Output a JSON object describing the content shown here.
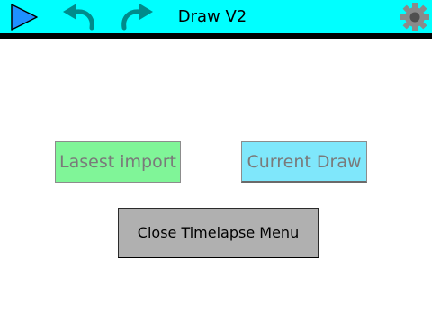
{
  "topbar": {
    "title": "Draw V2",
    "icons": {
      "play": "play-icon",
      "undo": "undo-icon",
      "redo": "redo-icon",
      "settings": "gear-icon"
    },
    "background_color": "#00ffff"
  },
  "main": {
    "latest_import_label": "Lasest import",
    "current_draw_label": "Current Draw",
    "close_timelapse_label": "Close Timelapse Menu"
  },
  "colors": {
    "accent": "#00ffff",
    "play_icon": "#1e90ff",
    "undo_redo_icon": "#008b8b",
    "gear_icon": "#8a8a8a",
    "latest_import_bg": "#80f598",
    "current_draw_bg": "#7fe7fb",
    "close_bg": "#b0b0b0"
  }
}
